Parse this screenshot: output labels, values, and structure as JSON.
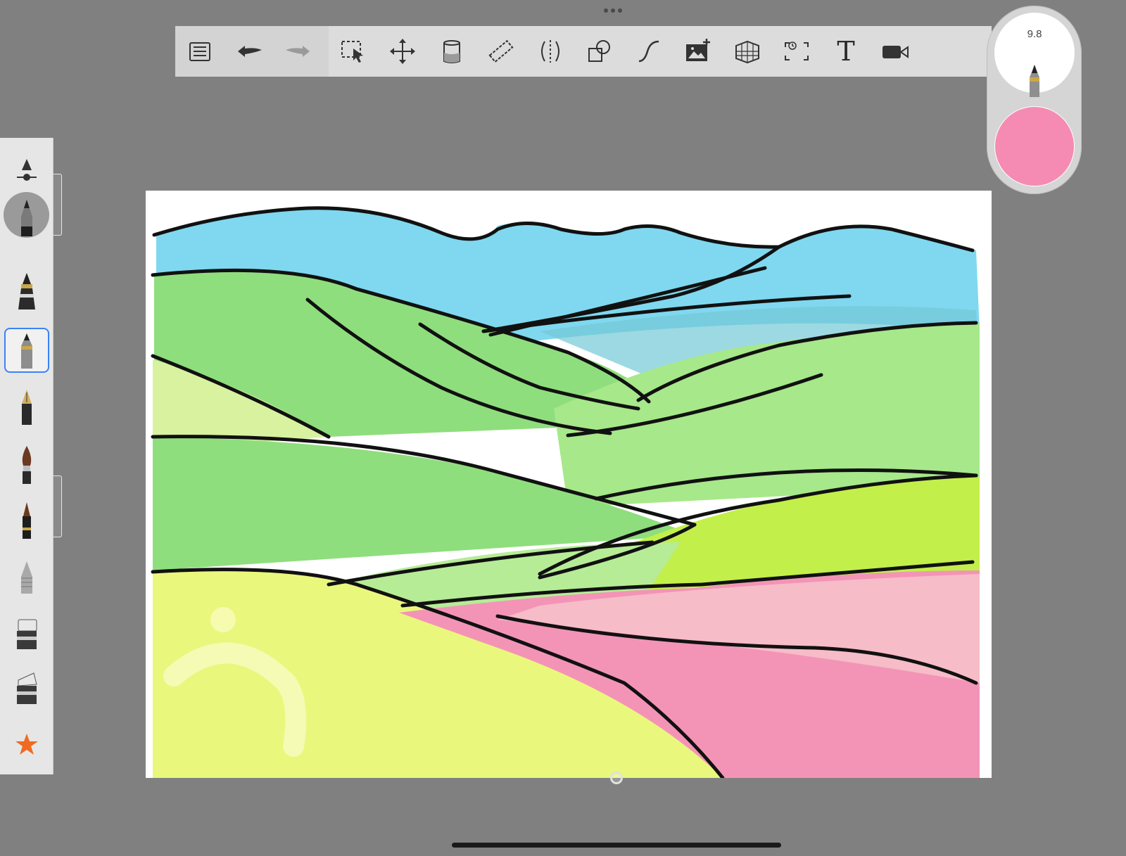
{
  "toolbar": {
    "items": [
      "list",
      "undo",
      "redo",
      "selection",
      "transform",
      "fill",
      "ruler",
      "symmetry",
      "shapes",
      "curve",
      "image",
      "perspective",
      "timelapse",
      "text",
      "record"
    ]
  },
  "puck": {
    "brush_size": "9.8",
    "color": "#f58bb3"
  },
  "brushes": {
    "items": [
      "brush-settings",
      "pencil",
      "ink-pen",
      "marker",
      "fountain-pen",
      "paint-brush",
      "airbrush",
      "smudge",
      "eraser",
      "eraser-soft",
      "favorite-star"
    ],
    "selected": "marker"
  },
  "canvas": {
    "palette": {
      "sky": "#ffffff",
      "mountains": "#7fd8ef",
      "hills_green": "#8fde7d",
      "hills_lime": "#c8f05a",
      "hills_yellow": "#eaf77d",
      "field_pink": "#f394b7",
      "outline": "#111111"
    }
  }
}
